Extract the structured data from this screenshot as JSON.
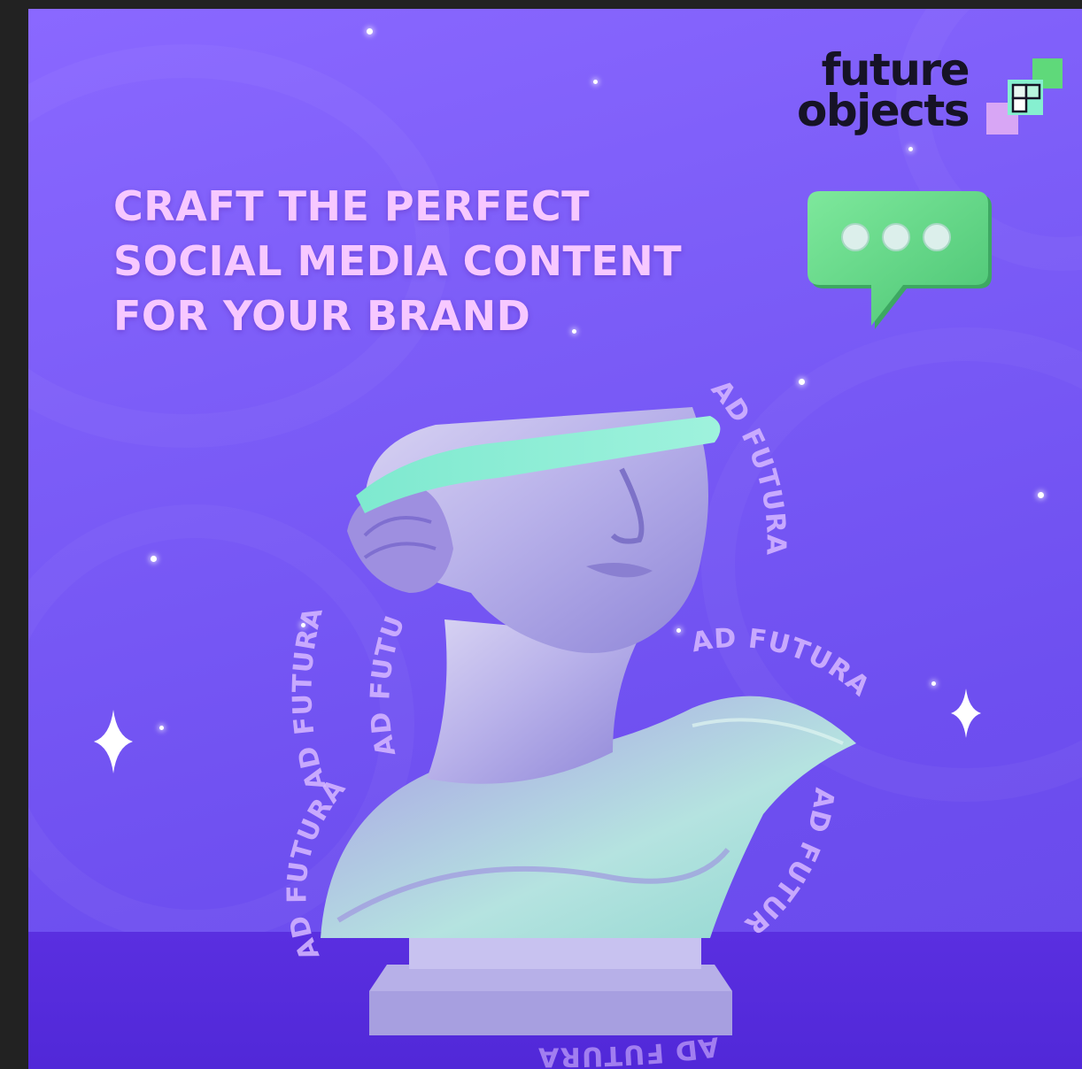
{
  "headline": {
    "line1": "CRAFT THE PERFECT",
    "line2": "SOCIAL MEDIA CONTENT",
    "line3": "FOR YOUR BRAND"
  },
  "logo": {
    "line1": "future",
    "line2": "objects"
  },
  "ring_text": "AD FUTURA",
  "colors": {
    "background": "#7b5cf7",
    "floor": "#5128d8",
    "headline": "#f7c8ff",
    "logo_text": "#161326",
    "accent_green": "#63d98a",
    "accent_mint": "#86f0d0",
    "accent_pink": "#d8a6f5"
  },
  "icons": [
    "logo-mark-icon",
    "chat-bubble-icon",
    "sparkle-icon"
  ]
}
